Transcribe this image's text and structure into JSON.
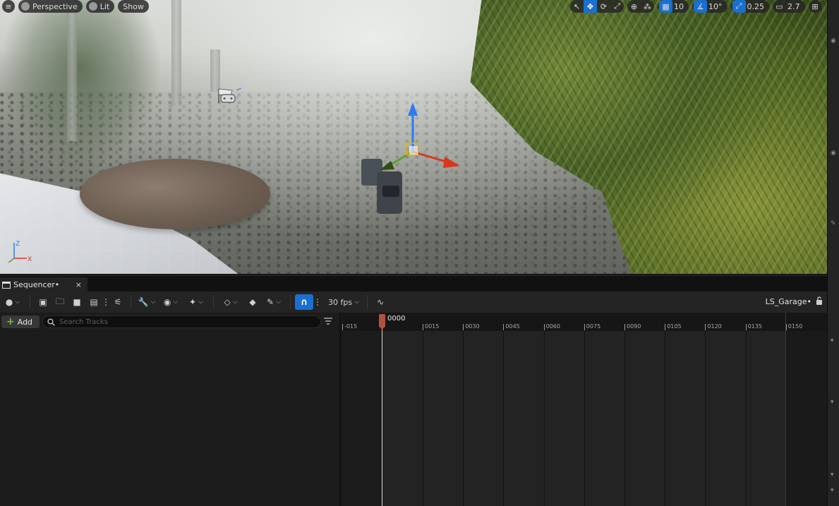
{
  "viewport": {
    "left_toolbar": {
      "menu_icon": "hamburger-icon",
      "perspective_label": "Perspective",
      "lit_label": "Lit",
      "show_label": "Show"
    },
    "right_toolbar": {
      "grid_snap_value": "10",
      "rotation_snap_value": "10°",
      "scale_snap_value": "0.25",
      "camera_speed_value": "2.7"
    },
    "accent_color": "#1a6fd1"
  },
  "sequencer": {
    "tab_label": "Sequencer•",
    "tab_close": "×",
    "fps_label": "30 fps",
    "sequence_name": "LS_Garage•",
    "add_label": "Add",
    "search_placeholder": "Search Tracks",
    "playhead_frame": "0000",
    "ruler_ticks": [
      "-015",
      "0015",
      "0030",
      "0045",
      "0060",
      "0075",
      "0090",
      "0105",
      "0120",
      "0135",
      "0150"
    ]
  }
}
